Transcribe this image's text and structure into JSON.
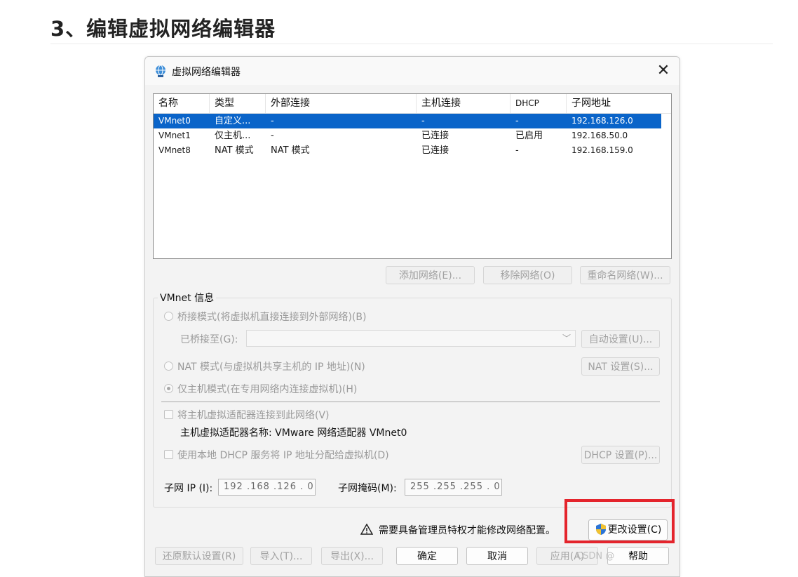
{
  "article": {
    "heading": "3、编辑虚拟网络编辑器"
  },
  "dialog": {
    "title": "虚拟网络编辑器",
    "close_glyph": "✕",
    "columns": [
      "名称",
      "类型",
      "外部连接",
      "主机连接",
      "DHCP",
      "子网地址"
    ],
    "rows": [
      [
        "VMnet0",
        "自定义...",
        "-",
        "-",
        "-",
        "192.168.126.0"
      ],
      [
        "VMnet1",
        "仅主机...",
        "-",
        "已连接",
        "已启用",
        "192.168.50.0"
      ],
      [
        "VMnet8",
        "NAT 模式",
        "NAT 模式",
        "已连接",
        "-",
        "192.168.159.0"
      ]
    ],
    "selected_row": 0,
    "buttons": {
      "add_network": "添加网络(E)...",
      "remove_network": "移除网络(O)",
      "rename_network": "重命名网络(W)..."
    },
    "info": {
      "group_title": "VMnet 信息",
      "bridged": "桥接模式(将虚拟机直接连接到外部网络)(B)",
      "bridged_to": "已桥接至(G):",
      "bridged_to_value": "",
      "auto_settings": "自动设置(U)...",
      "nat": "NAT 模式(与虚拟机共享主机的 IP 地址)(N)",
      "nat_settings": "NAT 设置(S)...",
      "host_only": "仅主机模式(在专用网络内连接虚拟机)(H)",
      "selected_mode": "host_only",
      "connect_adapter": "将主机虚拟适配器连接到此网络(V)",
      "adapter_name": "主机虚拟适配器名称: VMware 网络适配器 VMnet0",
      "use_dhcp": "使用本地 DHCP 服务将 IP 地址分配给虚拟机(D)",
      "dhcp_settings": "DHCP 设置(P)...",
      "subnet_ip_label": "子网 IP (I):",
      "subnet_ip": "192 .168 .126 .  0",
      "subnet_mask_label": "子网掩码(M):",
      "subnet_mask": "255 .255 .255 .  0"
    },
    "warning": "需要具备管理员特权才能修改网络配置。",
    "change_settings": "更改设置(C)",
    "footer": {
      "restore_defaults": "还原默认设置(R)",
      "import": "导入(T)...",
      "export": "导出(X)...",
      "ok": "确定",
      "cancel": "取消",
      "apply": "应用(A)",
      "help": "帮助"
    }
  },
  "watermark": "CSDN @"
}
